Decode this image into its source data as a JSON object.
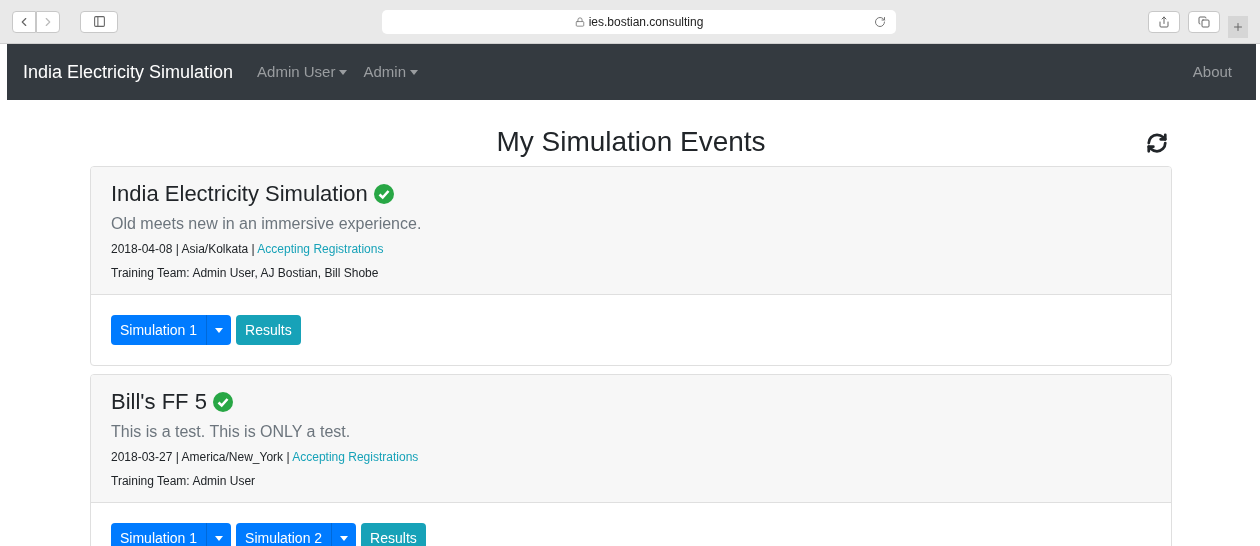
{
  "browser": {
    "url": "ies.bostian.consulting"
  },
  "navbar": {
    "brand": "India Electricity Simulation",
    "menus": [
      {
        "label": "Admin User"
      },
      {
        "label": "Admin"
      }
    ],
    "right_link": "About"
  },
  "page": {
    "title": "My Simulation Events"
  },
  "events": [
    {
      "title": "India Electricity Simulation",
      "verified": true,
      "description": "Old meets new in an immersive experience.",
      "meta": "2018-04-08 | Asia/Kolkata |",
      "status_link": "Accepting Registrations",
      "team": "Training Team: Admin User, AJ Bostian, Bill Shobe",
      "buttons": [
        {
          "label": "Simulation 1",
          "kind": "dropdown"
        },
        {
          "label": "Results",
          "kind": "plain"
        }
      ]
    },
    {
      "title": "Bill's FF 5",
      "verified": true,
      "description": "This is a test. This is ONLY a test.",
      "meta": "2018-03-27 | America/New_York |",
      "status_link": "Accepting Registrations",
      "team": "Training Team: Admin User",
      "buttons": [
        {
          "label": "Simulation 1",
          "kind": "dropdown"
        },
        {
          "label": "Simulation 2",
          "kind": "dropdown"
        },
        {
          "label": "Results",
          "kind": "plain"
        }
      ]
    }
  ]
}
